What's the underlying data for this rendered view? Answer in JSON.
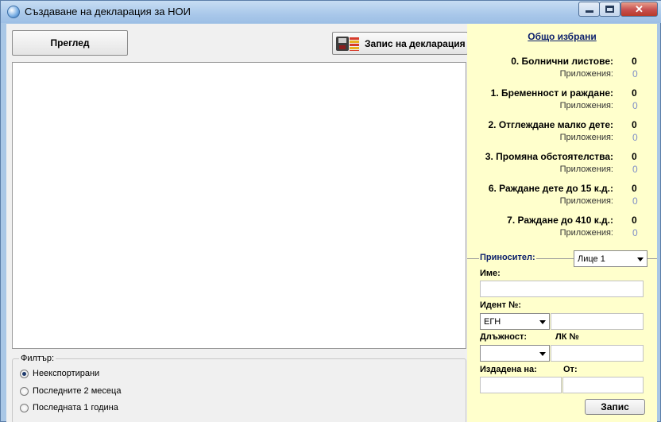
{
  "window": {
    "title": "Създаване на декларация за НОИ"
  },
  "toolbar": {
    "preview_label": "Преглед",
    "save_decl_label": "Запис на декларация"
  },
  "filter": {
    "legend": "Филтър:",
    "options": [
      {
        "label": "Неекспортирани",
        "checked": true
      },
      {
        "label": "Последните 2 месеца",
        "checked": false
      },
      {
        "label": "Последната 1 година",
        "checked": false
      }
    ]
  },
  "panel": {
    "title": "Общо избрани",
    "sub_label": "Приложения:",
    "stats": [
      {
        "label": "0. Болнични листове:",
        "value": "0",
        "attachments": "0"
      },
      {
        "label": "1. Бременност и раждане:",
        "value": "0",
        "attachments": "0"
      },
      {
        "label": "2. Отглеждане малко дете:",
        "value": "0",
        "attachments": "0"
      },
      {
        "label": "3. Промяна обстоятелства:",
        "value": "0",
        "attachments": "0"
      },
      {
        "label": "6. Раждане дете до 15 к.д.:",
        "value": "0",
        "attachments": "0"
      },
      {
        "label": "7. Раждане  до 410 к.д.:",
        "value": "0",
        "attachments": "0"
      }
    ],
    "bearer": {
      "group_label": "Приносител:",
      "person_select": "Лице 1",
      "name_label": "Име:",
      "name_value": "",
      "id_label": "Идент №:",
      "id_type": "ЕГН",
      "id_value": "",
      "position_label": "Длъжност:",
      "position_value": "",
      "lk_label": "ЛК №",
      "lk_value": "",
      "issued_label": "Издадена на:",
      "from_label": "От:",
      "issued_value": "",
      "from_value": "",
      "save_label": "Запис"
    }
  },
  "colors": {
    "panel_bg": "#ffffcc",
    "title_blue": "#0b1f6b",
    "attachment_value": "#7f8ec7"
  }
}
